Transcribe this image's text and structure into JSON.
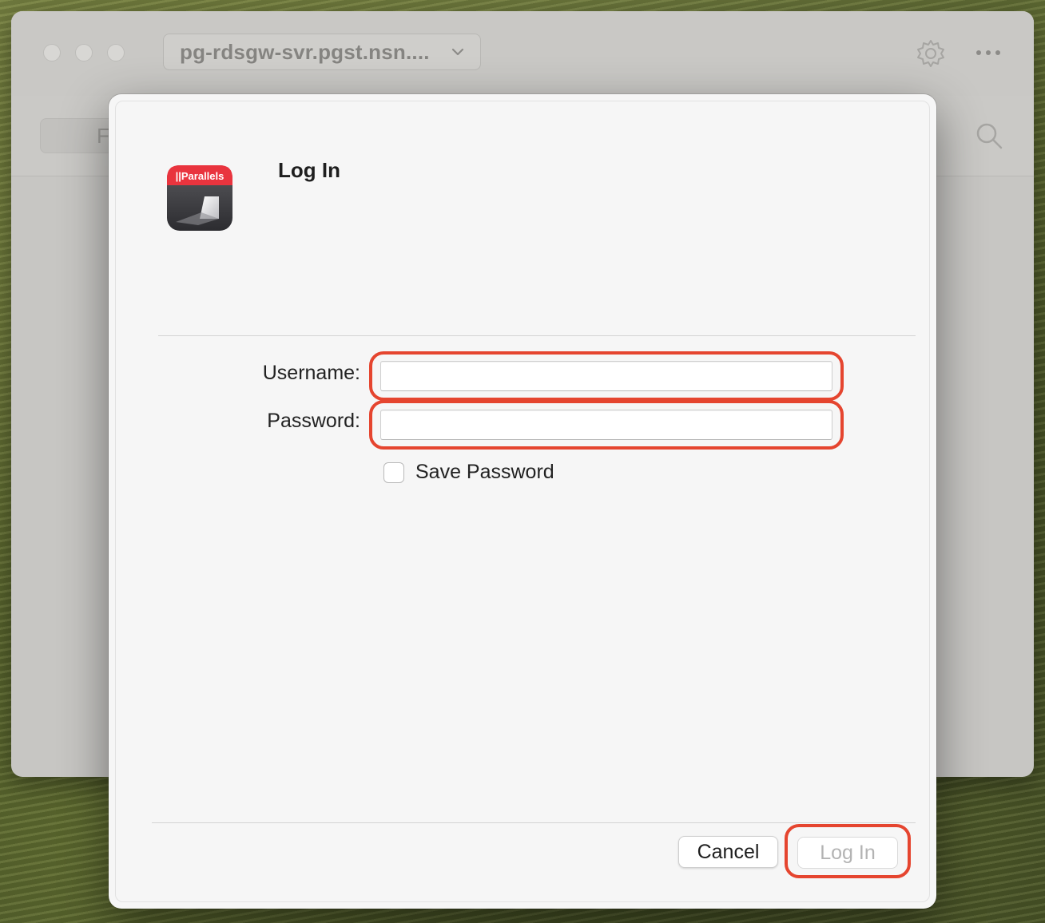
{
  "window": {
    "host_selector_value": "pg-rdsgw-svr.pgst.nsn....",
    "search_placeholder": "F"
  },
  "dialog": {
    "title": "Log In",
    "app_icon_text": "||Parallels",
    "username_label": "Username:",
    "username_value": "",
    "password_label": "Password:",
    "password_value": "",
    "save_password_label": "Save Password",
    "save_password_checked": false,
    "cancel_label": "Cancel",
    "login_label": "Log In",
    "login_enabled": false
  },
  "colors": {
    "highlight": "#e5452f",
    "icon_red": "#e9343e",
    "dialog_bg": "#f6f6f6"
  },
  "icons": [
    "chevron-down-icon",
    "gear-icon",
    "more-icon",
    "search-icon",
    "parallels-app-icon"
  ]
}
